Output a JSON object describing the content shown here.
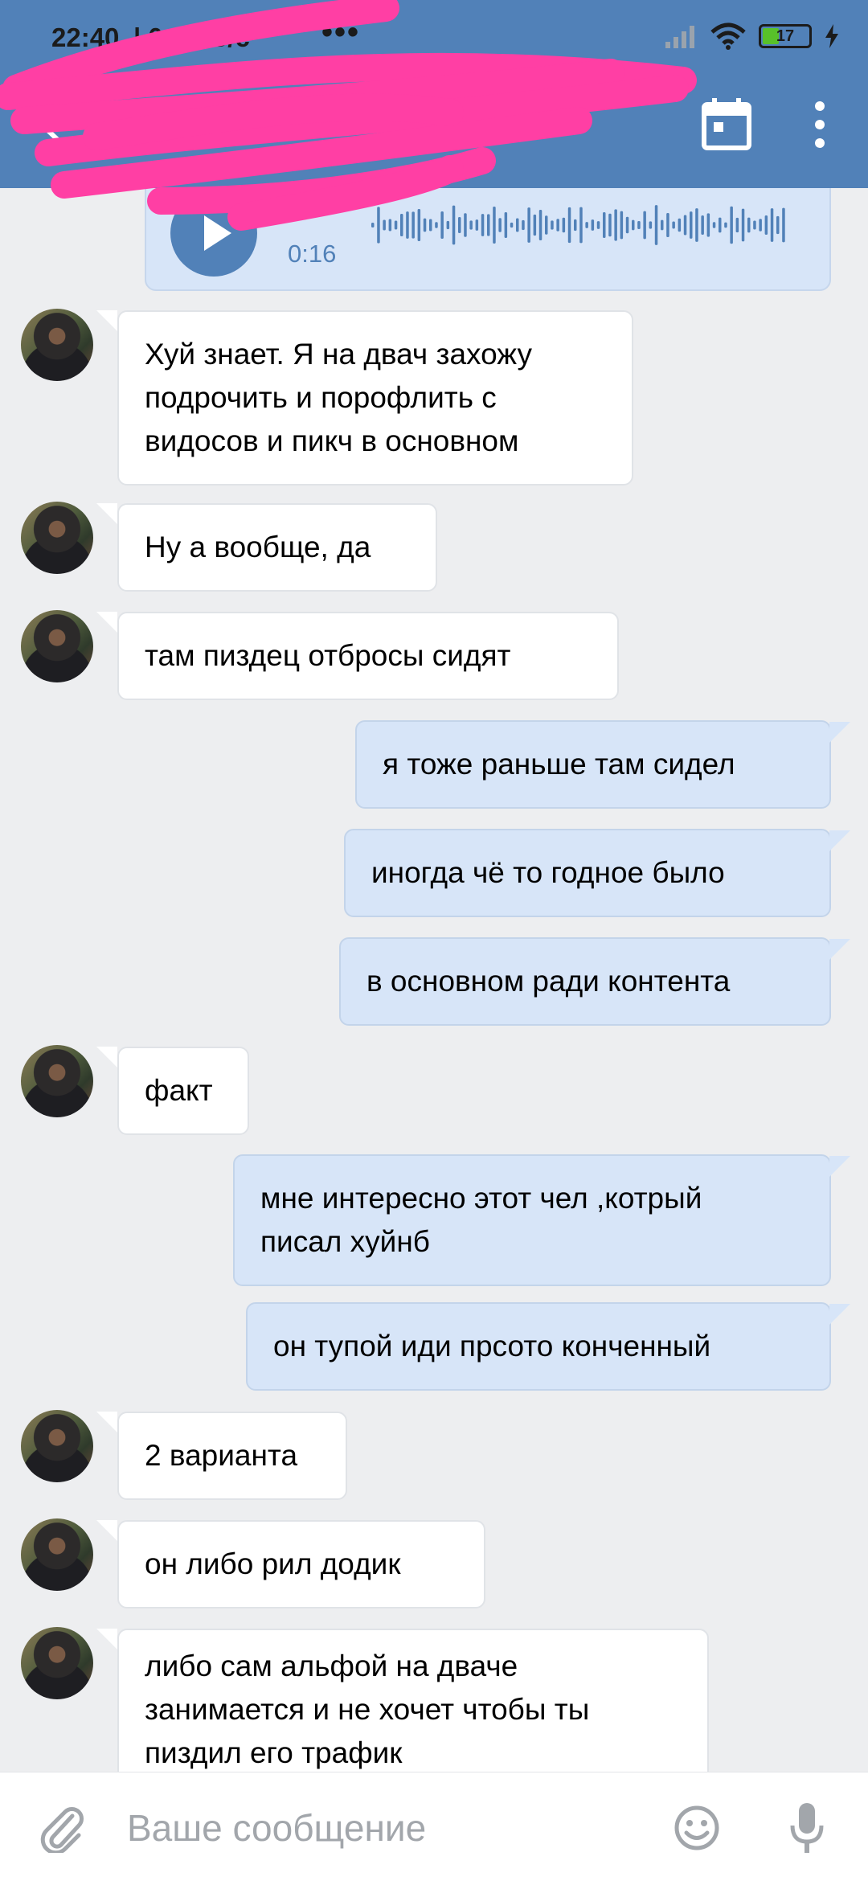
{
  "status_bar": {
    "time": "22:40",
    "speed": "| 0,0 КБ/с",
    "more": "•••",
    "battery": "17"
  },
  "header": {
    "back_icon": "arrow-left-icon",
    "calendar_icon": "calendar-icon",
    "more_icon": "more-vert-icon",
    "redaction_color": "#ff3fa4"
  },
  "voice_message": {
    "duration": "0:16",
    "play_icon": "play-icon"
  },
  "messages": [
    {
      "direction": "in",
      "lines": [
        "Хуй знает. Я на двач захожу",
        "подрочить и порофлить с",
        "видосов и пикч в основном"
      ]
    },
    {
      "direction": "in",
      "lines": [
        "Ну а вообще, да"
      ]
    },
    {
      "direction": "in",
      "lines": [
        "там пиздец отбросы сидят"
      ]
    },
    {
      "direction": "out",
      "lines": [
        "я тоже раньше там сидел"
      ]
    },
    {
      "direction": "out",
      "lines": [
        "иногда чё то годное было"
      ]
    },
    {
      "direction": "out",
      "lines": [
        "в основном ради контента"
      ]
    },
    {
      "direction": "in",
      "lines": [
        "факт"
      ]
    },
    {
      "direction": "out",
      "lines": [
        "мне интересно этот чел ,котрый",
        "писал хуйнб"
      ]
    },
    {
      "direction": "out",
      "lines": [
        "он тупой иди прсото конченный"
      ]
    },
    {
      "direction": "in",
      "lines": [
        "2 варианта"
      ]
    },
    {
      "direction": "in",
      "lines": [
        "он либо рил додик"
      ]
    },
    {
      "direction": "in",
      "lines": [
        "либо сам альфой на дваче",
        "занимается и не хочет чтобы ты",
        "пиздил его трафик"
      ]
    }
  ],
  "composer": {
    "placeholder": "Ваше сообщение",
    "attach_icon": "paperclip-icon",
    "emoji_icon": "emoji-icon",
    "mic_icon": "microphone-icon"
  },
  "colors": {
    "header": "#5181b8",
    "outgoing_bubble": "#d7e5f8",
    "incoming_bubble": "#ffffff",
    "background": "#edeef0"
  }
}
